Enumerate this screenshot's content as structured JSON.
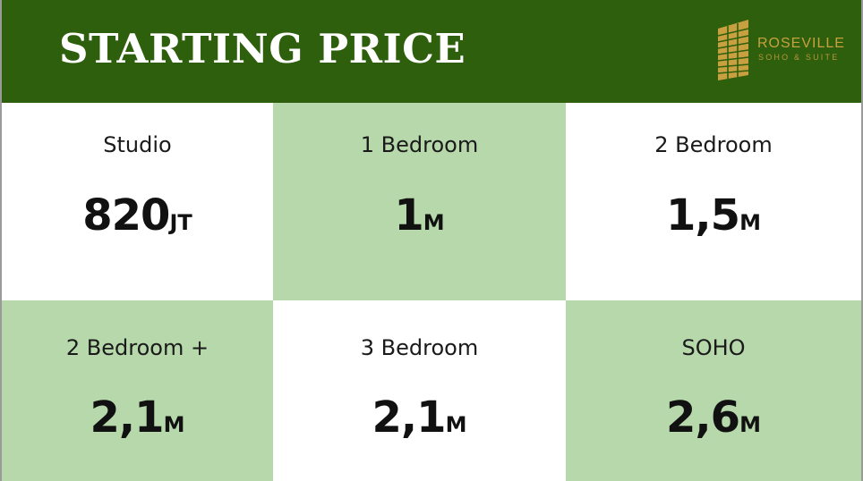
{
  "header": {
    "title": "STARTING PRICE",
    "logo": {
      "name": "ROSEVILLE",
      "tagline": "SOHO & SUITE",
      "icon": "building-logo-icon"
    }
  },
  "colors": {
    "header_bg": "#2d5f0c",
    "accent_gold": "#c9a040",
    "cell_green": "#b6d8ab",
    "cell_white": "#ffffff"
  },
  "units": [
    {
      "label": "Studio",
      "price": "820",
      "unit": "JT"
    },
    {
      "label": "1 Bedroom",
      "price": "1",
      "unit": "M"
    },
    {
      "label": "2 Bedroom",
      "price": "1,5",
      "unit": "M"
    },
    {
      "label": "2 Bedroom +",
      "price": "2,1",
      "unit": "M"
    },
    {
      "label": "3 Bedroom",
      "price": "2,1",
      "unit": "M"
    },
    {
      "label": "SOHO",
      "price": "2,6",
      "unit": "M"
    }
  ]
}
